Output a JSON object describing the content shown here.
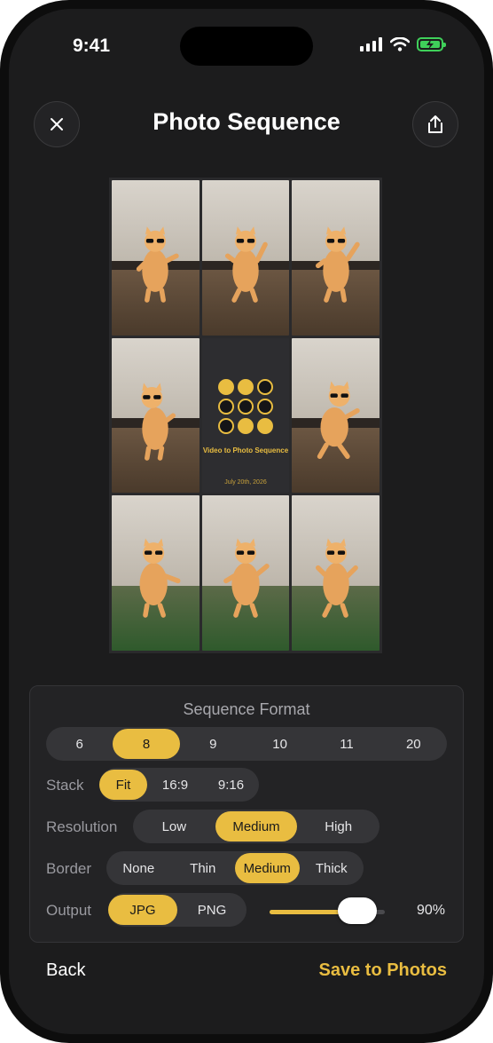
{
  "status_bar": {
    "time": "9:41"
  },
  "header": {
    "title": "Photo Sequence",
    "close_icon": "close-icon",
    "share_icon": "share-icon"
  },
  "preview": {
    "center_tile": {
      "title": "Video to Photo Sequence",
      "date": "July 20th, 2026"
    }
  },
  "panel": {
    "title": "Sequence Format",
    "counts": [
      {
        "label": "6",
        "selected": false
      },
      {
        "label": "8",
        "selected": true
      },
      {
        "label": "9",
        "selected": false
      },
      {
        "label": "10",
        "selected": false
      },
      {
        "label": "11",
        "selected": false
      },
      {
        "label": "20",
        "selected": false
      }
    ],
    "stack": {
      "label": "Stack",
      "options": [
        "Fit",
        "16:9",
        "9:16"
      ],
      "selected": "Fit"
    },
    "resolution": {
      "label": "Resolution",
      "options": [
        "Low",
        "Medium",
        "High"
      ],
      "selected": "Medium"
    },
    "border": {
      "label": "Border",
      "options": [
        "None",
        "Thin",
        "Medium",
        "Thick"
      ],
      "selected": "Medium"
    },
    "output": {
      "label": "Output",
      "options": [
        "JPG",
        "PNG"
      ],
      "selected": "JPG",
      "quality_value": 0.9,
      "quality_text": "90%"
    }
  },
  "footer": {
    "back_label": "Back",
    "save_label": "Save to Photos"
  },
  "colors": {
    "accent": "#e9bd41",
    "background": "#1c1c1d",
    "panel": "#232325"
  }
}
